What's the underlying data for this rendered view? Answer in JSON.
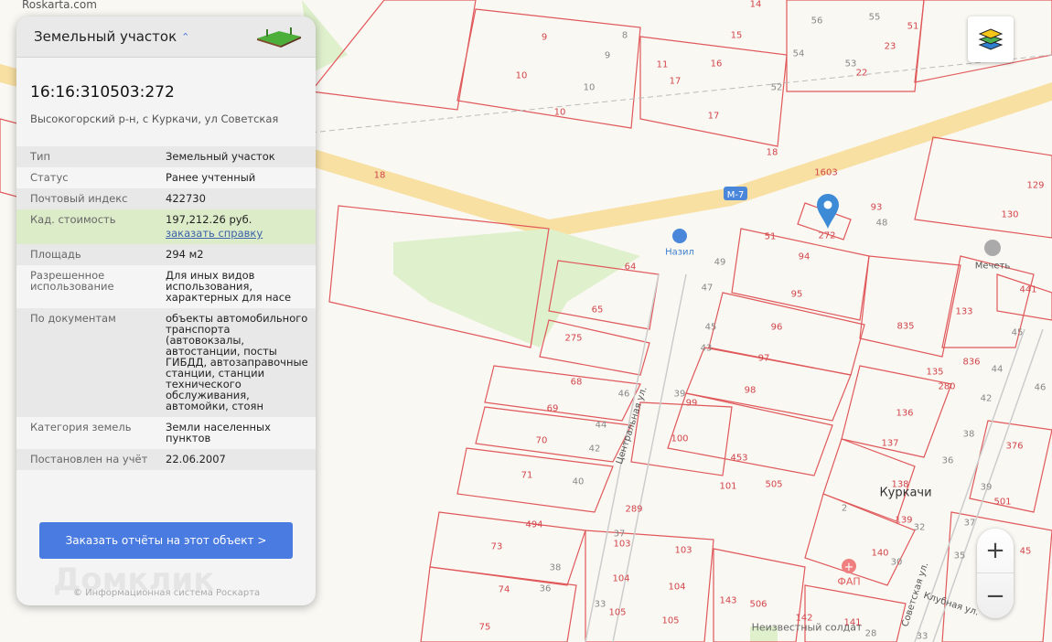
{
  "brand": "Roskarta.com",
  "panel": {
    "title": "Земельный участок",
    "cadastral_number": "16:16:310503:272",
    "address": "Высокогорский р-н, с Куркачи, ул Советская",
    "rows": [
      {
        "key": "Тип",
        "value": "Земельный участок"
      },
      {
        "key": "Статус",
        "value": "Ранее учтенный"
      },
      {
        "key": "Почтовый индекс",
        "value": "422730"
      },
      {
        "key": "Кад. стоимость",
        "value": "197,212.26 руб.",
        "link": "заказать справку"
      },
      {
        "key": "Площадь",
        "value": "294 м2"
      },
      {
        "key": "Разрешенное использование",
        "value": "Для иных видов использования, характерных для насе"
      },
      {
        "key": "По документам",
        "value": "объекты автомобильного транспорта (автовокзалы, автостанции, посты ГИБДД, автозаправочные станции, станции технического обслуживания, автомойки, стоян"
      },
      {
        "key": "Категория земель",
        "value": "Земли населенных пунктов"
      },
      {
        "key": "Постановлен на учёт",
        "value": "22.06.2007"
      }
    ],
    "order_button": "Заказать отчёты на этот объект >",
    "watermark": "Домклик",
    "copyright": "© Информационная система Роскарта"
  },
  "map": {
    "colors": {
      "parcel": "#e0585a",
      "road": "#f7d98f",
      "green": "#dff0cc",
      "marker": "#3d8ad6"
    },
    "parcel_labels": [
      "18",
      "1603",
      "93",
      "94",
      "95",
      "96",
      "97",
      "98",
      "99",
      "100",
      "101",
      "453",
      "505",
      "138",
      "139",
      "140",
      "141",
      "143",
      "506",
      "142",
      "64",
      "65",
      "275",
      "68",
      "69",
      "70",
      "71",
      "73",
      "74",
      "75",
      "103",
      "103",
      "104",
      "104",
      "105",
      "105",
      "129",
      "130",
      "133",
      "835",
      "836",
      "135",
      "280",
      "136",
      "137",
      "376",
      "501",
      "45",
      "441",
      "9",
      "10",
      "10",
      "15",
      "16",
      "17",
      "17",
      "14",
      "23",
      "51",
      "22",
      "18",
      "11",
      "289",
      "494",
      "51",
      "272"
    ],
    "house_numbers": [
      "8",
      "9",
      "10",
      "56",
      "54",
      "52",
      "53",
      "55",
      "49",
      "47",
      "45",
      "43",
      "46",
      "44",
      "42",
      "40",
      "39",
      "38",
      "36",
      "37",
      "33",
      "35",
      "37",
      "39",
      "30",
      "32",
      "2",
      "28",
      "33",
      "44",
      "42",
      "38",
      "36",
      "46",
      "45",
      "48"
    ],
    "places": {
      "village": "Куркачи",
      "mosque": "Мечеть",
      "shop": "Назил",
      "fap": "ФАП",
      "central_st": "Центральная ул.",
      "sovetskaya_st": "Советская ул.",
      "klubnaya_st": "Клубная ул.",
      "monument": "Неизвестный солдат",
      "highway": "М-7"
    }
  },
  "controls": {
    "zoom_in": "+",
    "zoom_out": "−",
    "layers_icon": "layers-icon"
  }
}
